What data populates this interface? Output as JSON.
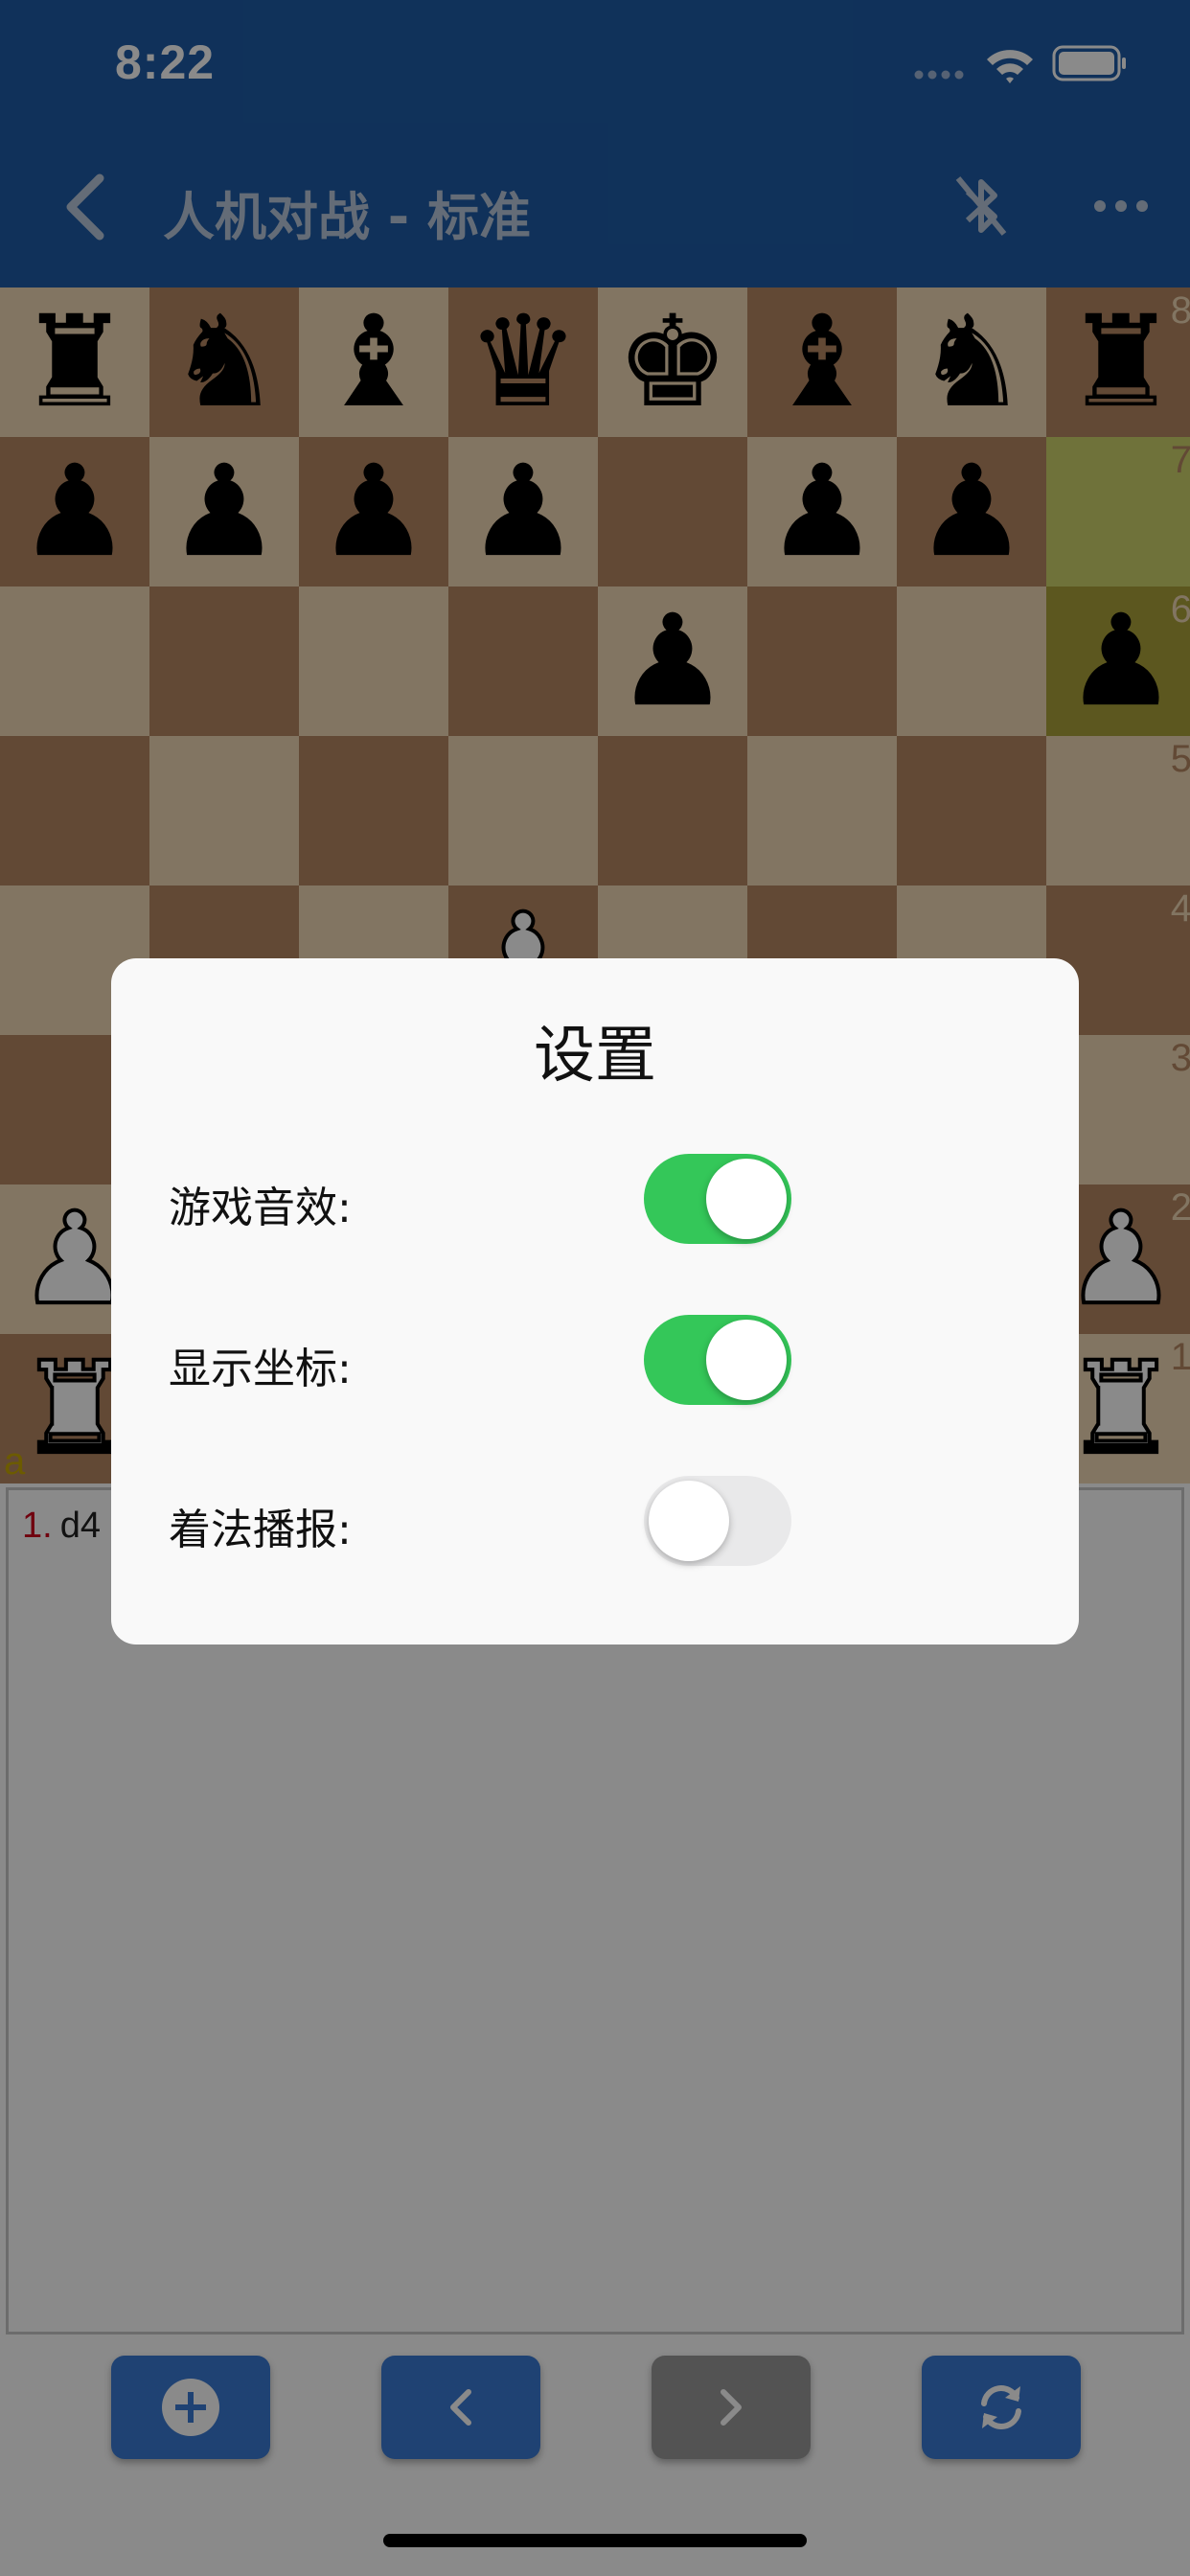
{
  "status_bar": {
    "time": "8:22"
  },
  "nav": {
    "title": "人机对战 - 标准",
    "back_icon": "chevron-left-icon",
    "bluetooth_icon": "bluetooth-off-icon",
    "more_icon": "more-horizontal-icon"
  },
  "board": {
    "ranks": [
      "8",
      "7",
      "6",
      "5",
      "4",
      "3",
      "2",
      "1"
    ],
    "files": [
      "a"
    ],
    "position_fen_rows": [
      "rnbqkbnr",
      "pppp1pp1",
      "4p2p",
      "8",
      "3P4",
      "8",
      "PPP1PPPP",
      "RNBQKBNR"
    ],
    "last_move_highlight": [
      "h7",
      "h6"
    ],
    "colors": {
      "light": "#f0d9b5",
      "dark": "#b58863",
      "highlight_light": "#ced26b",
      "highlight_dark": "#aaa23a",
      "coord": "#c8a800"
    }
  },
  "moves": [
    {
      "number": "1.",
      "san": "d4"
    }
  ],
  "toolbar": {
    "buttons": [
      {
        "name": "new-game-button",
        "icon": "plus-circle-icon",
        "enabled": true
      },
      {
        "name": "previous-move-button",
        "icon": "chevron-left-icon",
        "enabled": true
      },
      {
        "name": "next-move-button",
        "icon": "chevron-right-icon",
        "enabled": false
      },
      {
        "name": "flip-board-button",
        "icon": "refresh-icon",
        "enabled": true
      }
    ]
  },
  "dialog": {
    "title": "设置",
    "settings": [
      {
        "label": "游戏音效:",
        "on": true
      },
      {
        "label": "显示坐标:",
        "on": true
      },
      {
        "label": "着法播报:",
        "on": false
      }
    ]
  }
}
